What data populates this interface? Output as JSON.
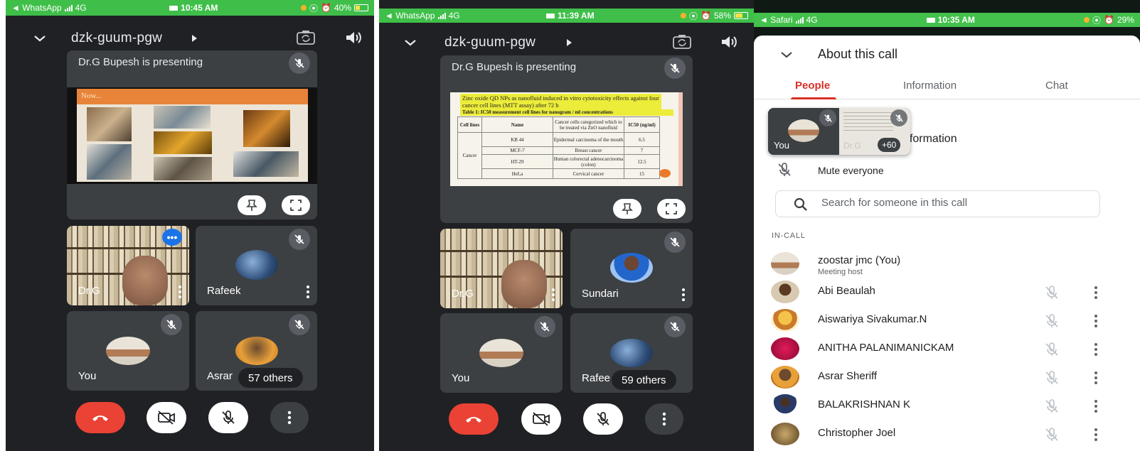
{
  "screen1": {
    "status": {
      "app": "◄ WhatsApp",
      "network": "4G",
      "time": "10:45 AM",
      "battery": "40%"
    },
    "meeting_code": "dzk-guum-pgw",
    "presenting_label": "Dr.G Bupesh is presenting",
    "slide_heading": "Now...",
    "tiles": [
      {
        "name": "Dr.G"
      },
      {
        "name": "Rafeek"
      },
      {
        "name": "You"
      },
      {
        "name": "Asrar"
      }
    ],
    "others_label": "57 others"
  },
  "screen2": {
    "status": {
      "app": "◄ WhatsApp",
      "network": "4G",
      "time": "11:39 AM",
      "battery": "58%"
    },
    "meeting_code": "dzk-guum-pgw",
    "presenting_label": "Dr.G Bupesh is presenting",
    "slide": {
      "title": "Zinc oxide QD NPs as nanofluid induced in vitro cytotoxicity effects against four cancer cell lines (MTT assay) after 72 h",
      "table_caption": "Table 1: IC50 measurement cell lines for nanogram / ml concentrations",
      "headers": [
        "Cell lines",
        "Name",
        "Cancer cells categorized which to be treated via ZnO nanofluid",
        "IC50 (ng/ml)"
      ],
      "group": "Cancer",
      "rows": [
        [
          "KB 44",
          "Epidermal carcinoma of the mouth",
          "6.5"
        ],
        [
          "MCF-7",
          "Breast cancer",
          "7"
        ],
        [
          "HT-29",
          "Human colorectal adenocarcinoma (colon)",
          "12.5"
        ],
        [
          "HeLa",
          "Cervical cancer",
          "15"
        ]
      ]
    },
    "tiles": [
      {
        "name": "Dr.G"
      },
      {
        "name": "Sundari"
      },
      {
        "name": "You"
      },
      {
        "name": "Rafee"
      }
    ],
    "others_label": "59 others"
  },
  "screen3": {
    "status": {
      "app": "◄ Safari",
      "network": "4G",
      "time": "10:35 AM",
      "battery": "29%"
    },
    "title": "About this call",
    "tabs": [
      "People",
      "Information",
      "Chat"
    ],
    "active_tab": "People",
    "add_people_partial": "nformation",
    "mute_everyone": "Mute everyone",
    "search_placeholder": "Search for someone in this call",
    "in_call_label": "IN-CALL",
    "pip": {
      "you_label": "You",
      "name_label": "Dr.G",
      "count_badge": "+60"
    },
    "people": [
      {
        "name": "zoostar jmc (You)",
        "subtitle": "Meeting host"
      },
      {
        "name": "Abi Beaulah"
      },
      {
        "name": "Aiswariya Sivakumar.N"
      },
      {
        "name": "ANITHA PALANIMANICKAM"
      },
      {
        "name": "Asrar Sheriff"
      },
      {
        "name": "BALAKRISHNAN K"
      },
      {
        "name": "Christopher Joel"
      }
    ]
  },
  "colors": {
    "meet_dark": "#202124",
    "tile": "#3c4043",
    "end_call": "#ea4335",
    "accent_red": "#d93025",
    "status_green": "#3fbf4a"
  }
}
